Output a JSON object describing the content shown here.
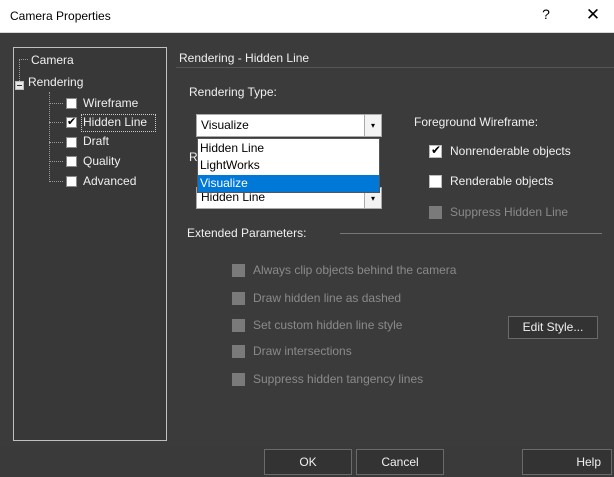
{
  "window": {
    "title": "Camera Properties",
    "help_glyph": "?",
    "close_glyph": "✕"
  },
  "tree": {
    "items": [
      {
        "label": "Camera"
      },
      {
        "label": "Rendering"
      },
      {
        "label": "Wireframe",
        "checked": false
      },
      {
        "label": "Hidden Line",
        "checked": true
      },
      {
        "label": "Draft",
        "checked": false
      },
      {
        "label": "Quality",
        "checked": false
      },
      {
        "label": "Advanced",
        "checked": false
      }
    ]
  },
  "panel": {
    "title": "Rendering - Hidden Line",
    "rendering_type_label": "Rendering Type:",
    "rendering_type_value": "Visualize",
    "dropdown_options": [
      "Hidden Line",
      "LightWorks",
      "Visualize"
    ],
    "dropdown_selected": "Visualize",
    "second_label_partial": "R",
    "second_combo_value": "Hidden Line",
    "foreground_wireframe_label": "Foreground Wireframe:",
    "nonrenderable_label": "Nonrenderable objects",
    "nonrenderable_checked": true,
    "renderable_label": "Renderable objects",
    "renderable_checked": false,
    "suppress_hidden_line_label": "Suppress Hidden Line",
    "extended_label": "Extended Parameters:",
    "extended": [
      "Always clip objects behind the camera",
      "Draw hidden line as dashed",
      "Set custom hidden line style",
      "Draw intersections",
      "Suppress hidden tangency lines"
    ],
    "edit_style_label": "Edit Style..."
  },
  "buttons": {
    "ok": "OK",
    "cancel": "Cancel",
    "help": "Help"
  },
  "check_glyph": "✔",
  "arrow_glyph": "▾",
  "colors": {
    "background": "#3b3b3b",
    "selection": "#0078d7"
  }
}
